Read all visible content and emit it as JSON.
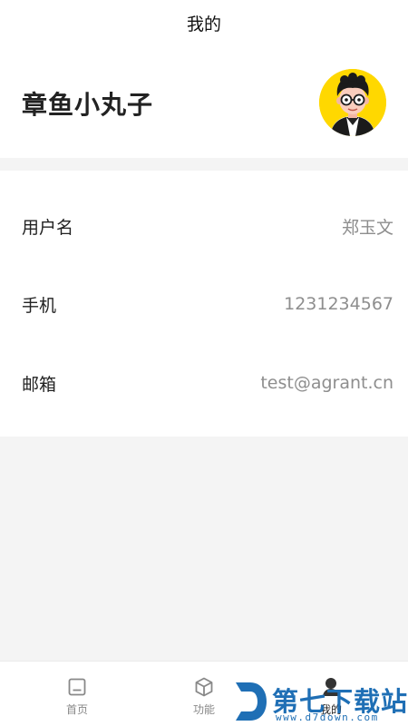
{
  "nav": {
    "title": "我的"
  },
  "profile": {
    "name": "章鱼小丸子",
    "avatar_icon": "cartoon-avatar-icon",
    "avatar_bg": "#ffd800"
  },
  "info": {
    "rows": [
      {
        "label": "用户名",
        "value": "郑玉文"
      },
      {
        "label": "手机",
        "value": "1231234567"
      },
      {
        "label": "邮箱",
        "value": "test@agrant.cn"
      }
    ]
  },
  "tabs": [
    {
      "label": "首页",
      "icon": "home-icon"
    },
    {
      "label": "功能",
      "icon": "cube-icon"
    },
    {
      "label": "我的",
      "icon": "person-icon",
      "active": true
    }
  ],
  "watermark": {
    "text": "第七下载站",
    "url": "www.d7down.com",
    "color": "#1f6fb5"
  }
}
